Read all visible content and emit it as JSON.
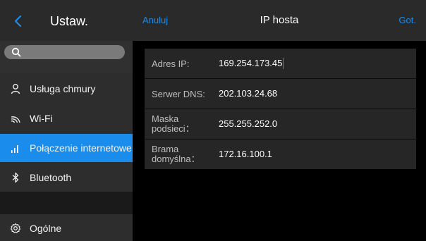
{
  "colors": {
    "accent": "#1a8cec",
    "sidebar_bg": "#303030",
    "header_bg": "#2a2a2a",
    "panel_bg": "#262626",
    "main_bg": "#000000"
  },
  "sidebar": {
    "back_icon": "chevron-left-icon",
    "title": "Ustaw.",
    "search": {
      "icon": "search-icon",
      "value": "",
      "placeholder": ""
    },
    "items": [
      {
        "label": "Usługa chmury",
        "icon": "person-icon",
        "active": false
      },
      {
        "label": "Wi-Fi",
        "icon": "wifi-icon",
        "active": false
      },
      {
        "label": "Połączenie internetowe",
        "icon": "signal-bars-icon",
        "active": true
      },
      {
        "label": "Bluetooth",
        "icon": "bluetooth-icon",
        "active": false
      },
      {
        "label": "Ogólne",
        "icon": "gear-icon",
        "active": false
      }
    ]
  },
  "header": {
    "cancel_label": "Anuluj",
    "title": "IP hosta",
    "done_label": "Got."
  },
  "form": {
    "rows": [
      {
        "label": "Adres IP:",
        "value": "169.254.173.45",
        "focused": true
      },
      {
        "label": "Serwer DNS:",
        "value": "202.103.24.68",
        "focused": false
      },
      {
        "label_line1": "Maska",
        "label_line2": "podsieci：",
        "value": "255.255.252.0",
        "focused": false
      },
      {
        "label_line1": "Brama",
        "label_line2": "domyślna：",
        "value": "172.16.100.1",
        "focused": false
      }
    ]
  }
}
